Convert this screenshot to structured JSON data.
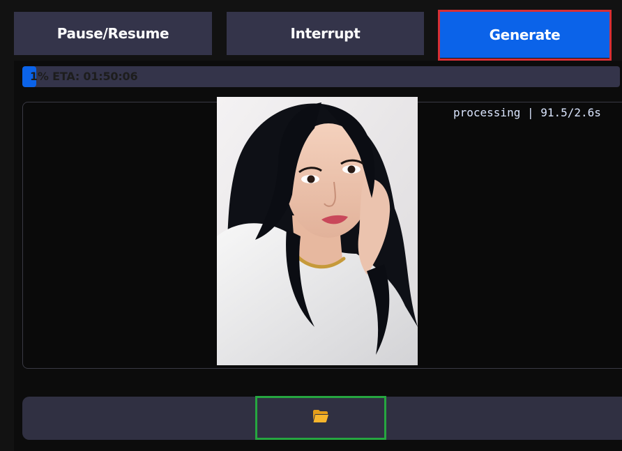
{
  "toolbar": {
    "pause_resume_label": "Pause/Resume",
    "interrupt_label": "Interrupt",
    "generate_label": "Generate"
  },
  "progress": {
    "text": "1% ETA: 01:50:06",
    "percent": 1
  },
  "status": {
    "text": "processing | 91.5/2.6s"
  },
  "preview": {
    "subject": "portrait of a woman with long black hair in a white t-shirt and gold chain necklace"
  },
  "folder_button": {
    "icon": "folder-open-icon"
  },
  "colors": {
    "primary": "#0b63e9",
    "secondary": "#34344a",
    "highlight_red": "#d72f35",
    "highlight_green": "#26a640",
    "status_text": "#dbe6ff",
    "folder_icon": "#f7b52c"
  }
}
